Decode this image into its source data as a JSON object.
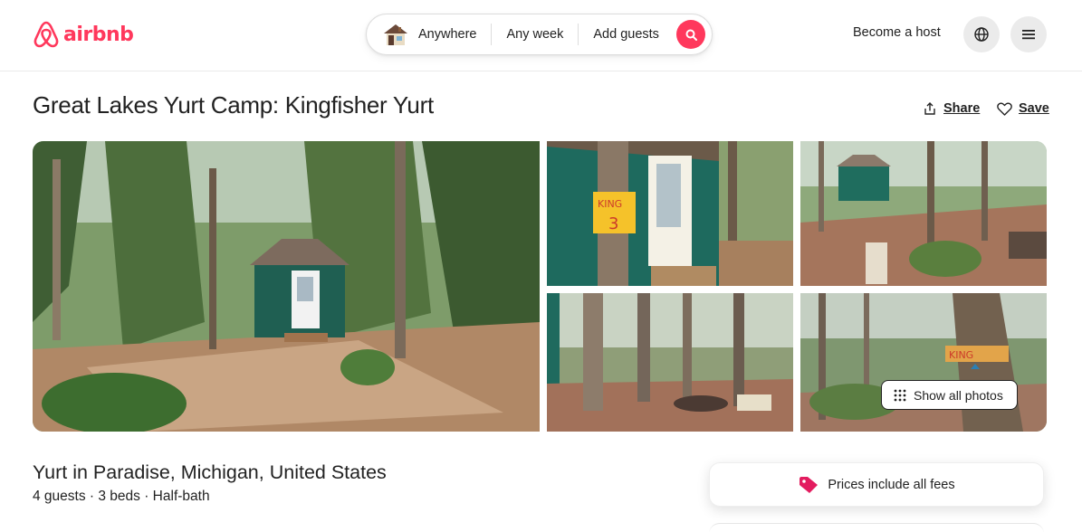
{
  "header": {
    "logo_text": "airbnb",
    "search": {
      "location": "Anywhere",
      "dates": "Any week",
      "guests": "Add guests"
    },
    "host_link": "Become a host"
  },
  "listing": {
    "title": "Great Lakes Yurt Camp: Kingfisher Yurt",
    "share_label": "Share",
    "save_label": "Save",
    "subtitle": "Yurt in Paradise, Michigan, United States",
    "details": "4 guests · 3 beds · Half-bath"
  },
  "gallery": {
    "show_all_label": "Show all photos",
    "sign_text_1": "KING",
    "sign_text_2": "3",
    "sign_text_3": "KING"
  },
  "booking": {
    "fees_label": "Prices include all fees"
  },
  "colors": {
    "brand": "#ff385c",
    "text": "#222222",
    "muted_bg": "#ebebeb"
  },
  "icons": [
    "airbnb-logo-icon",
    "house-thumbnail-icon",
    "search-icon",
    "globe-icon",
    "menu-icon",
    "share-icon",
    "heart-icon",
    "grid-dots-icon",
    "price-tag-icon"
  ]
}
